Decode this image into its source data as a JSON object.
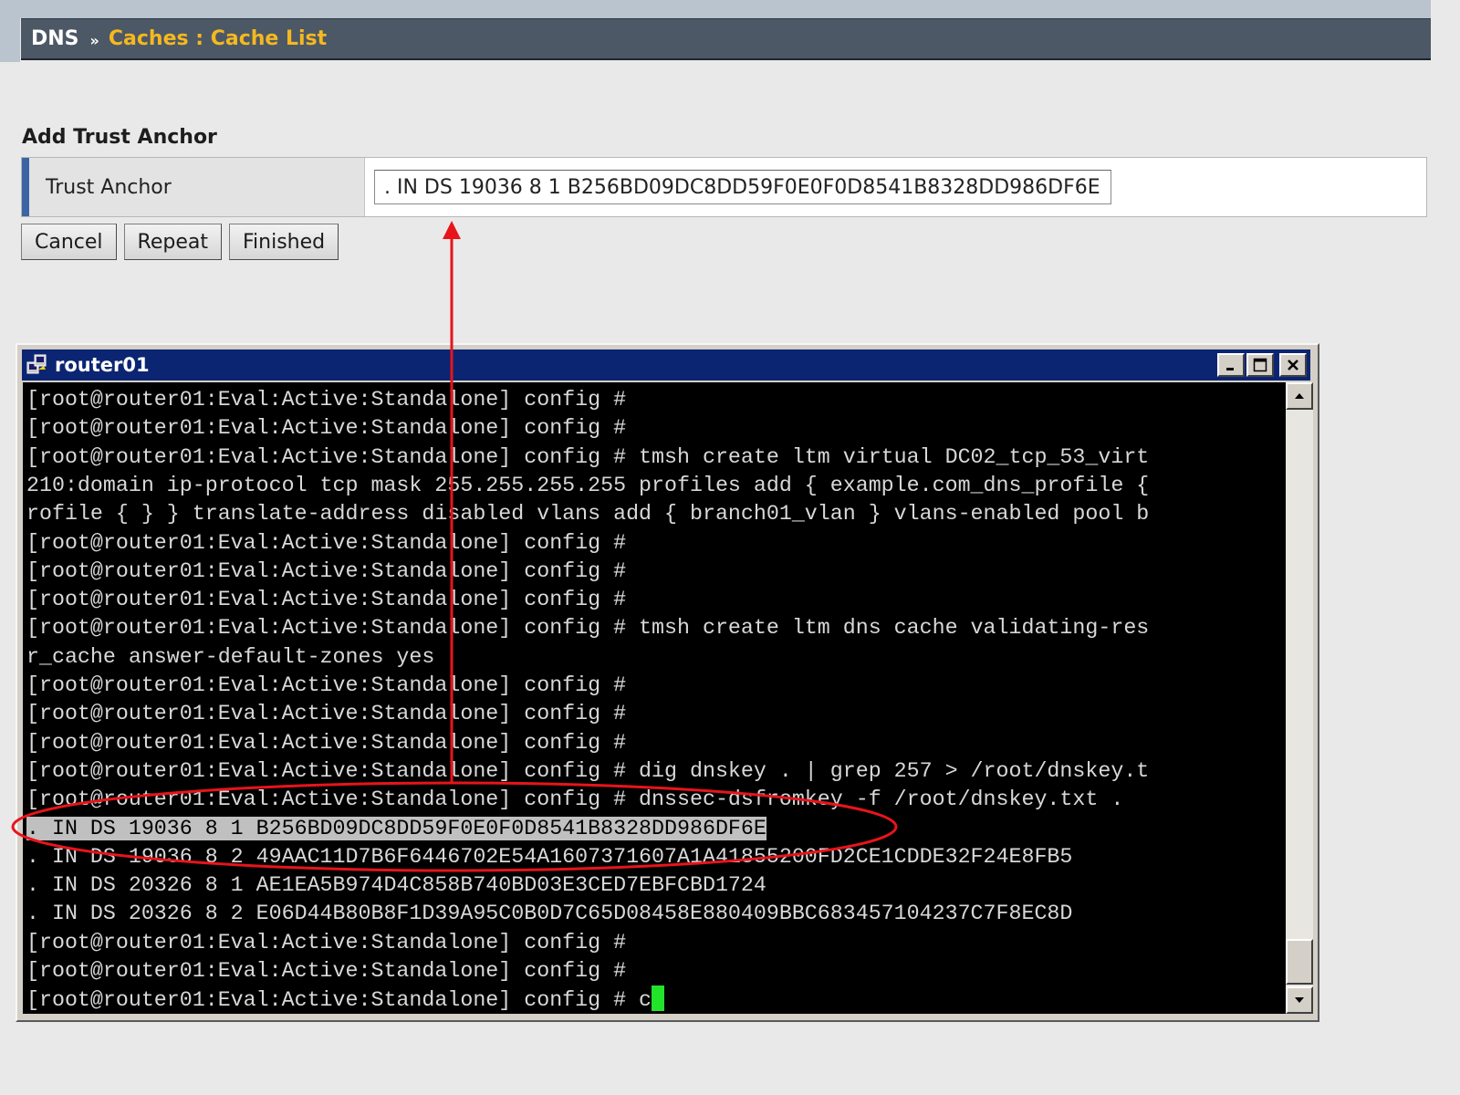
{
  "header": {
    "root": "DNS",
    "separator": "»",
    "crumb": "Caches : Cache List"
  },
  "form": {
    "section_title": "Add Trust Anchor",
    "field_label": "Trust Anchor",
    "field_value": ". IN DS 19036 8 1 B256BD09DC8DD59F0E0F0D8541B8328DD986DF6E",
    "buttons": {
      "cancel": "Cancel",
      "repeat": "Repeat",
      "finished": "Finished"
    }
  },
  "terminal": {
    "title": "router01",
    "lines": [
      "[root@router01:Eval:Active:Standalone] config #",
      "[root@router01:Eval:Active:Standalone] config #",
      "[root@router01:Eval:Active:Standalone] config # tmsh create ltm virtual DC02_tcp_53_virt",
      "210:domain ip-protocol tcp mask 255.255.255.255 profiles add { example.com_dns_profile {",
      "rofile { } } translate-address disabled vlans add { branch01_vlan } vlans-enabled pool b",
      "[root@router01:Eval:Active:Standalone] config #",
      "[root@router01:Eval:Active:Standalone] config #",
      "[root@router01:Eval:Active:Standalone] config #",
      "[root@router01:Eval:Active:Standalone] config # tmsh create ltm dns cache validating-res",
      "r_cache answer-default-zones yes",
      "[root@router01:Eval:Active:Standalone] config #",
      "[root@router01:Eval:Active:Standalone] config #",
      "[root@router01:Eval:Active:Standalone] config #",
      "[root@router01:Eval:Active:Standalone] config # dig dnskey . | grep 257 > /root/dnskey.t",
      "[root@router01:Eval:Active:Standalone] config # dnssec-dsfromkey -f /root/dnskey.txt .",
      ". IN DS 19036 8 1 B256BD09DC8DD59F0E0F0D8541B8328DD986DF6E",
      ". IN DS 19036 8 2 49AAC11D7B6F6446702E54A1607371607A1A41855200FD2CE1CDDE32F24E8FB5",
      ". IN DS 20326 8 1 AE1EA5B974D4C858B740BD03E3CED7EBFCBD1724",
      ". IN DS 20326 8 2 E06D44B80B8F1D39A95C0B0D7C65D08458E880409BBC683457104237C7F8EC8D",
      "[root@router01:Eval:Active:Standalone] config #",
      "[root@router01:Eval:Active:Standalone] config #",
      "[root@router01:Eval:Active:Standalone] config # c"
    ],
    "selected_line_index": 15
  },
  "colors": {
    "header_bg": "#4c5866",
    "crumb_link": "#f5b81f",
    "label_accent": "#3a64a3",
    "titlebar": "#0b2573",
    "annotation": "#e8141b",
    "cursor": "#22e22a"
  }
}
